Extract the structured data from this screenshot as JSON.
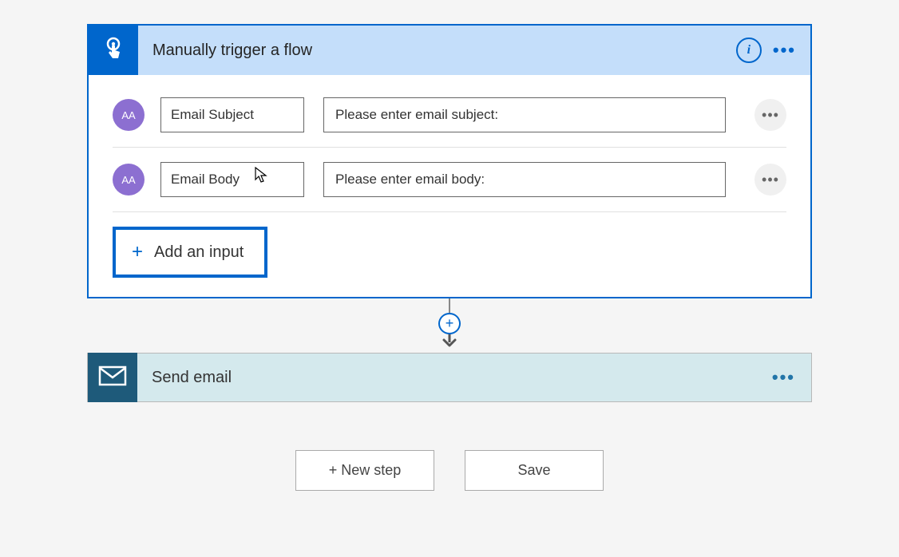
{
  "trigger": {
    "title": "Manually trigger a flow",
    "inputs": [
      {
        "name": "Email Subject",
        "description": "Please enter email subject:",
        "typeLabel": "AA"
      },
      {
        "name": "Email Body",
        "description": "Please enter email body:",
        "typeLabel": "AA"
      }
    ],
    "addInputLabel": "Add an input"
  },
  "action": {
    "title": "Send email"
  },
  "footer": {
    "newStep": "+ New step",
    "save": "Save"
  }
}
